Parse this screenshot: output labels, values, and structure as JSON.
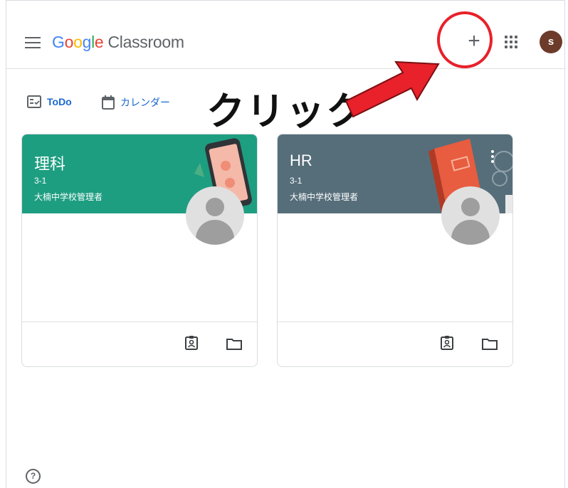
{
  "header": {
    "logo_google": "Google",
    "logo_classroom": "Classroom",
    "plus_label": "+",
    "avatar_letter": "s"
  },
  "nav": {
    "todo_label": "ToDo",
    "calendar_label": "カレンダー"
  },
  "annotation": {
    "text": "クリック",
    "circle_color": "#e8212a",
    "arrow_color": "#e8212a"
  },
  "cards": [
    {
      "title": "理科",
      "section": "3-1",
      "owner": "大楠中学校管理者",
      "color": "#1e9e81"
    },
    {
      "title": "HR",
      "section": "3-1",
      "owner": "大楠中学校管理者",
      "color": "#566e7a"
    }
  ],
  "footer": {
    "help_label": "?"
  },
  "icons": {
    "menu": "hamburger-icon",
    "apps": "apps-grid-icon",
    "todo": "todo-list-icon",
    "calendar": "calendar-icon",
    "assignment": "assignment-icon",
    "folder": "folder-icon",
    "help": "help-icon"
  }
}
